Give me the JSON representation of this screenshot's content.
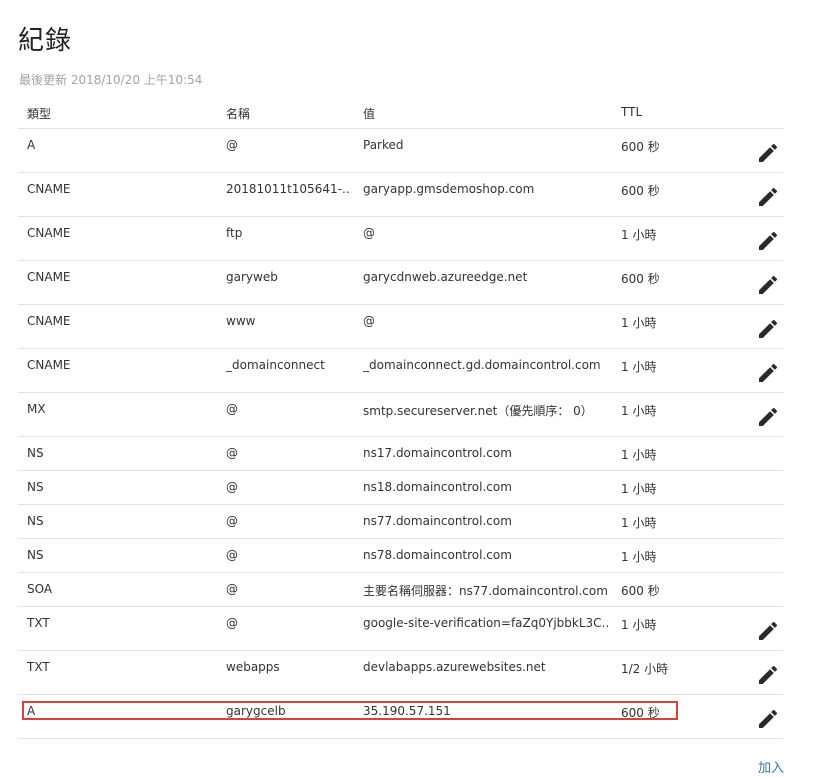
{
  "page": {
    "title": "紀錄",
    "last_updated": "最後更新 2018/10/20 上午10:54",
    "add_label": "加入"
  },
  "table": {
    "headers": {
      "type": "類型",
      "name": "名稱",
      "value": "值",
      "ttl": "TTL"
    },
    "rows": [
      {
        "type": "A",
        "name": "@",
        "value": "Parked",
        "ttl": "600 秒",
        "editable": true
      },
      {
        "type": "CNAME",
        "name": "20181011t105641-…",
        "value": "garyapp.gmsdemoshop.com",
        "ttl": "600 秒",
        "editable": true
      },
      {
        "type": "CNAME",
        "name": "ftp",
        "value": "@",
        "ttl": "1 小時",
        "editable": true
      },
      {
        "type": "CNAME",
        "name": "garyweb",
        "value": "garycdnweb.azureedge.net",
        "ttl": "600 秒",
        "editable": true
      },
      {
        "type": "CNAME",
        "name": "www",
        "value": "@",
        "ttl": "1 小時",
        "editable": true
      },
      {
        "type": "CNAME",
        "name": "_domainconnect",
        "value": "_domainconnect.gd.domaincontrol.com",
        "ttl": "1 小時",
        "editable": true
      },
      {
        "type": "MX",
        "name": "@",
        "value": "smtp.secureserver.net（優先順序： 0）",
        "ttl": "1 小時",
        "editable": true
      },
      {
        "type": "NS",
        "name": "@",
        "value": "ns17.domaincontrol.com",
        "ttl": "1 小時",
        "editable": false
      },
      {
        "type": "NS",
        "name": "@",
        "value": "ns18.domaincontrol.com",
        "ttl": "1 小時",
        "editable": false
      },
      {
        "type": "NS",
        "name": "@",
        "value": "ns77.domaincontrol.com",
        "ttl": "1 小時",
        "editable": false
      },
      {
        "type": "NS",
        "name": "@",
        "value": "ns78.domaincontrol.com",
        "ttl": "1 小時",
        "editable": false
      },
      {
        "type": "SOA",
        "name": "@",
        "value": "主要名稱伺服器：ns77.domaincontrol.com.",
        "ttl": "600 秒",
        "editable": false
      },
      {
        "type": "TXT",
        "name": "@",
        "value": "google-site-verification=faZq0YjbbkL3C…",
        "ttl": "1 小時",
        "editable": true
      },
      {
        "type": "TXT",
        "name": "webapps",
        "value": "devlabapps.azurewebsites.net",
        "ttl": "1/2 小時",
        "editable": true
      },
      {
        "type": "A",
        "name": "garygcelb",
        "value": "35.190.57.151",
        "ttl": "600 秒",
        "editable": true,
        "highlighted": true
      }
    ]
  },
  "icons": {
    "edit": "pencil-icon"
  },
  "colors": {
    "highlight_border": "#d9413f",
    "link": "#2b7bb9",
    "divider": "#e2e2e2",
    "muted": "#a3a3a3"
  }
}
